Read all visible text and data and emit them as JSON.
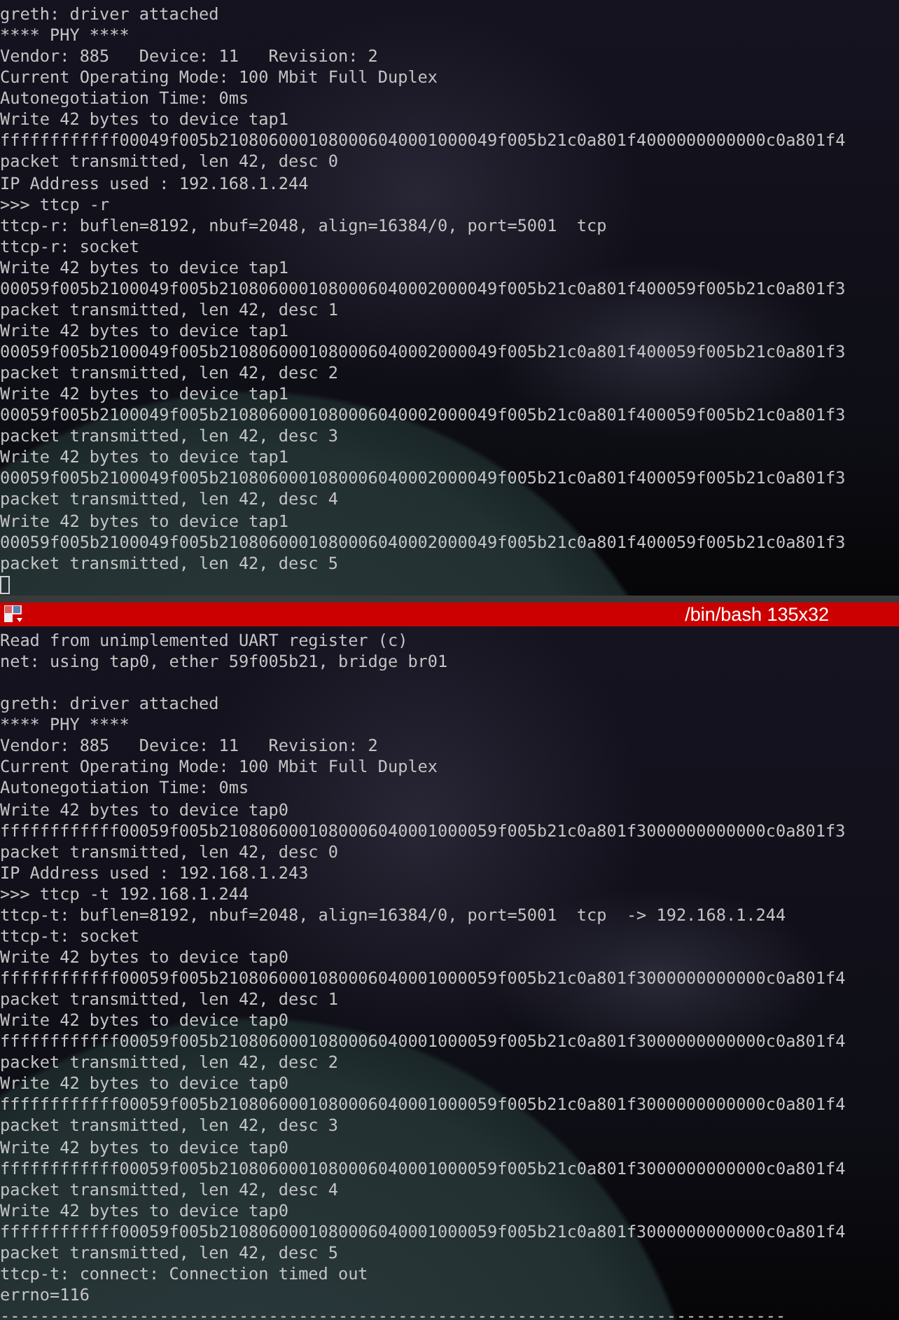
{
  "top_pane": {
    "lines": [
      "greth: driver attached",
      "**** PHY ****",
      "Vendor: 885   Device: 11   Revision: 2",
      "Current Operating Mode: 100 Mbit Full Duplex",
      "Autonegotiation Time: 0ms",
      "Write 42 bytes to device tap1",
      "ffffffffffff00049f005b2108060001080006040001000049f005b21c0a801f4000000000000c0a801f4",
      "packet transmitted, len 42, desc 0",
      "IP Address used : 192.168.1.244",
      ">>> ttcp -r",
      "ttcp-r: buflen=8192, nbuf=2048, align=16384/0, port=5001  tcp",
      "ttcp-r: socket",
      "Write 42 bytes to device tap1",
      "00059f005b2100049f005b2108060001080006040002000049f005b21c0a801f400059f005b21c0a801f3",
      "packet transmitted, len 42, desc 1",
      "Write 42 bytes to device tap1",
      "00059f005b2100049f005b2108060001080006040002000049f005b21c0a801f400059f005b21c0a801f3",
      "packet transmitted, len 42, desc 2",
      "Write 42 bytes to device tap1",
      "00059f005b2100049f005b2108060001080006040002000049f005b21c0a801f400059f005b21c0a801f3",
      "packet transmitted, len 42, desc 3",
      "Write 42 bytes to device tap1",
      "00059f005b2100049f005b2108060001080006040002000049f005b21c0a801f400059f005b21c0a801f3",
      "packet transmitted, len 42, desc 4",
      "Write 42 bytes to device tap1",
      "00059f005b2100049f005b2108060001080006040002000049f005b21c0a801f400059f005b21c0a801f3",
      "packet transmitted, len 42, desc 5"
    ]
  },
  "bottom_pane": {
    "title": "/bin/bash 135x32",
    "blocks": [
      [
        "Read from unimplemented UART register (c)",
        "net: using tap0, ether 59f005b21, bridge br01"
      ],
      [
        "greth: driver attached",
        "**** PHY ****",
        "Vendor: 885   Device: 11   Revision: 2",
        "Current Operating Mode: 100 Mbit Full Duplex",
        "Autonegotiation Time: 0ms",
        "Write 42 bytes to device tap0",
        "ffffffffffff00059f005b2108060001080006040001000059f005b21c0a801f3000000000000c0a801f3",
        "packet transmitted, len 42, desc 0",
        "IP Address used : 192.168.1.243",
        ">>> ttcp -t 192.168.1.244",
        "ttcp-t: buflen=8192, nbuf=2048, align=16384/0, port=5001  tcp  -> 192.168.1.244",
        "ttcp-t: socket",
        "Write 42 bytes to device tap0",
        "ffffffffffff00059f005b2108060001080006040001000059f005b21c0a801f3000000000000c0a801f4",
        "packet transmitted, len 42, desc 1",
        "Write 42 bytes to device tap0",
        "ffffffffffff00059f005b2108060001080006040001000059f005b21c0a801f3000000000000c0a801f4",
        "packet transmitted, len 42, desc 2",
        "Write 42 bytes to device tap0",
        "ffffffffffff00059f005b2108060001080006040001000059f005b21c0a801f3000000000000c0a801f4",
        "packet transmitted, len 42, desc 3",
        "Write 42 bytes to device tap0",
        "ffffffffffff00059f005b2108060001080006040001000059f005b21c0a801f3000000000000c0a801f4",
        "packet transmitted, len 42, desc 4",
        "Write 42 bytes to device tap0",
        "ffffffffffff00059f005b2108060001080006040001000059f005b21c0a801f3000000000000c0a801f4",
        "packet transmitted, len 42, desc 5",
        "ttcp-t: connect: Connection timed out",
        "errno=116",
        "-------------------------------------------------------------------------------"
      ]
    ]
  }
}
